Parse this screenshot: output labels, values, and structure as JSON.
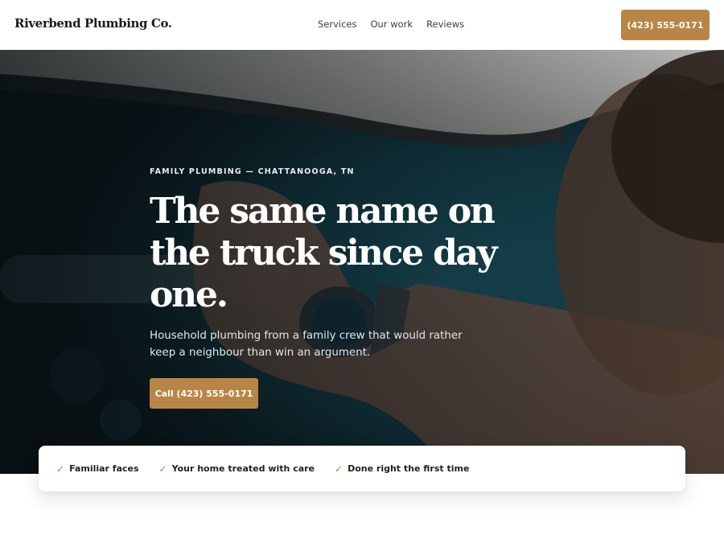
{
  "header": {
    "brand": "Riverbend Plumbing Co.",
    "nav": [
      "Services",
      "Our work",
      "Reviews"
    ],
    "cta_label": "(423) 555-0171"
  },
  "hero": {
    "eyebrow": "FAMILY PLUMBING — CHATTANOOGA, TN",
    "headline": "The same name on the truck since day one.",
    "subtext": "Household plumbing from a family crew that would rather keep a neighbour than win an argument.",
    "cta_label": "Call (423) 555-0171"
  },
  "trust": {
    "items": [
      "Familiar faces",
      "Your home treated with care",
      "Done right the first time"
    ],
    "icon": "check-icon"
  },
  "colors": {
    "accent": "#b88546",
    "hero_overlay": "#12242b",
    "white": "#ffffff"
  }
}
